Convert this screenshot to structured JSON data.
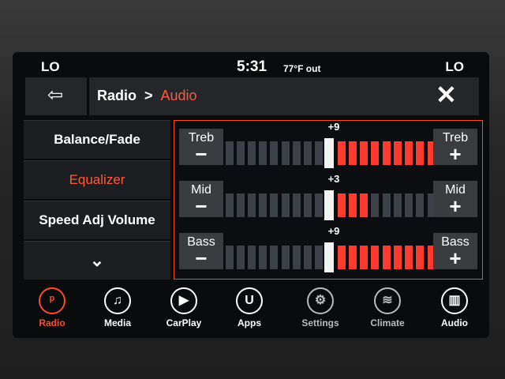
{
  "status": {
    "left_zone": "LO",
    "time": "5:31",
    "outside_temp": "77°F out",
    "right_zone": "LO"
  },
  "header": {
    "back_icon": "back-arrow-icon",
    "crumb_root": "Radio",
    "crumb_separator": ">",
    "crumb_current": "Audio",
    "close_icon": "close-icon"
  },
  "menu": {
    "items": [
      {
        "label": "Balance/Fade",
        "active": false
      },
      {
        "label": "Equalizer",
        "active": true
      },
      {
        "label": "Speed Adj Volume",
        "active": false
      }
    ],
    "more_icon": "chevron-down-icon"
  },
  "equalizer": {
    "bands": [
      {
        "name": "Treb",
        "value": "+9",
        "level": 9,
        "min": -9,
        "max": 9
      },
      {
        "name": "Mid",
        "value": "+3",
        "level": 3,
        "min": -9,
        "max": 9
      },
      {
        "name": "Bass",
        "value": "+9",
        "level": 9,
        "min": -9,
        "max": 9
      }
    ],
    "minus_symbol": "−",
    "plus_symbol": "+"
  },
  "nav": {
    "items": [
      {
        "label": "Radio",
        "icon": "radio-tower-icon",
        "active": true
      },
      {
        "label": "Media",
        "icon": "music-note-icon",
        "active": false
      },
      {
        "label": "CarPlay",
        "icon": "carplay-icon",
        "active": false
      },
      {
        "label": "Apps",
        "icon": "apps-icon",
        "active": false
      },
      {
        "label": "Settings",
        "icon": "gear-icon",
        "active": false
      },
      {
        "label": "Climate",
        "icon": "climate-icon",
        "active": false
      },
      {
        "label": "Audio",
        "icon": "audio-icon",
        "active": false
      }
    ]
  },
  "colors": {
    "accent": "#ff4a2a",
    "bar_on": "#ff3b2f",
    "bar_off": "#3b4146"
  }
}
